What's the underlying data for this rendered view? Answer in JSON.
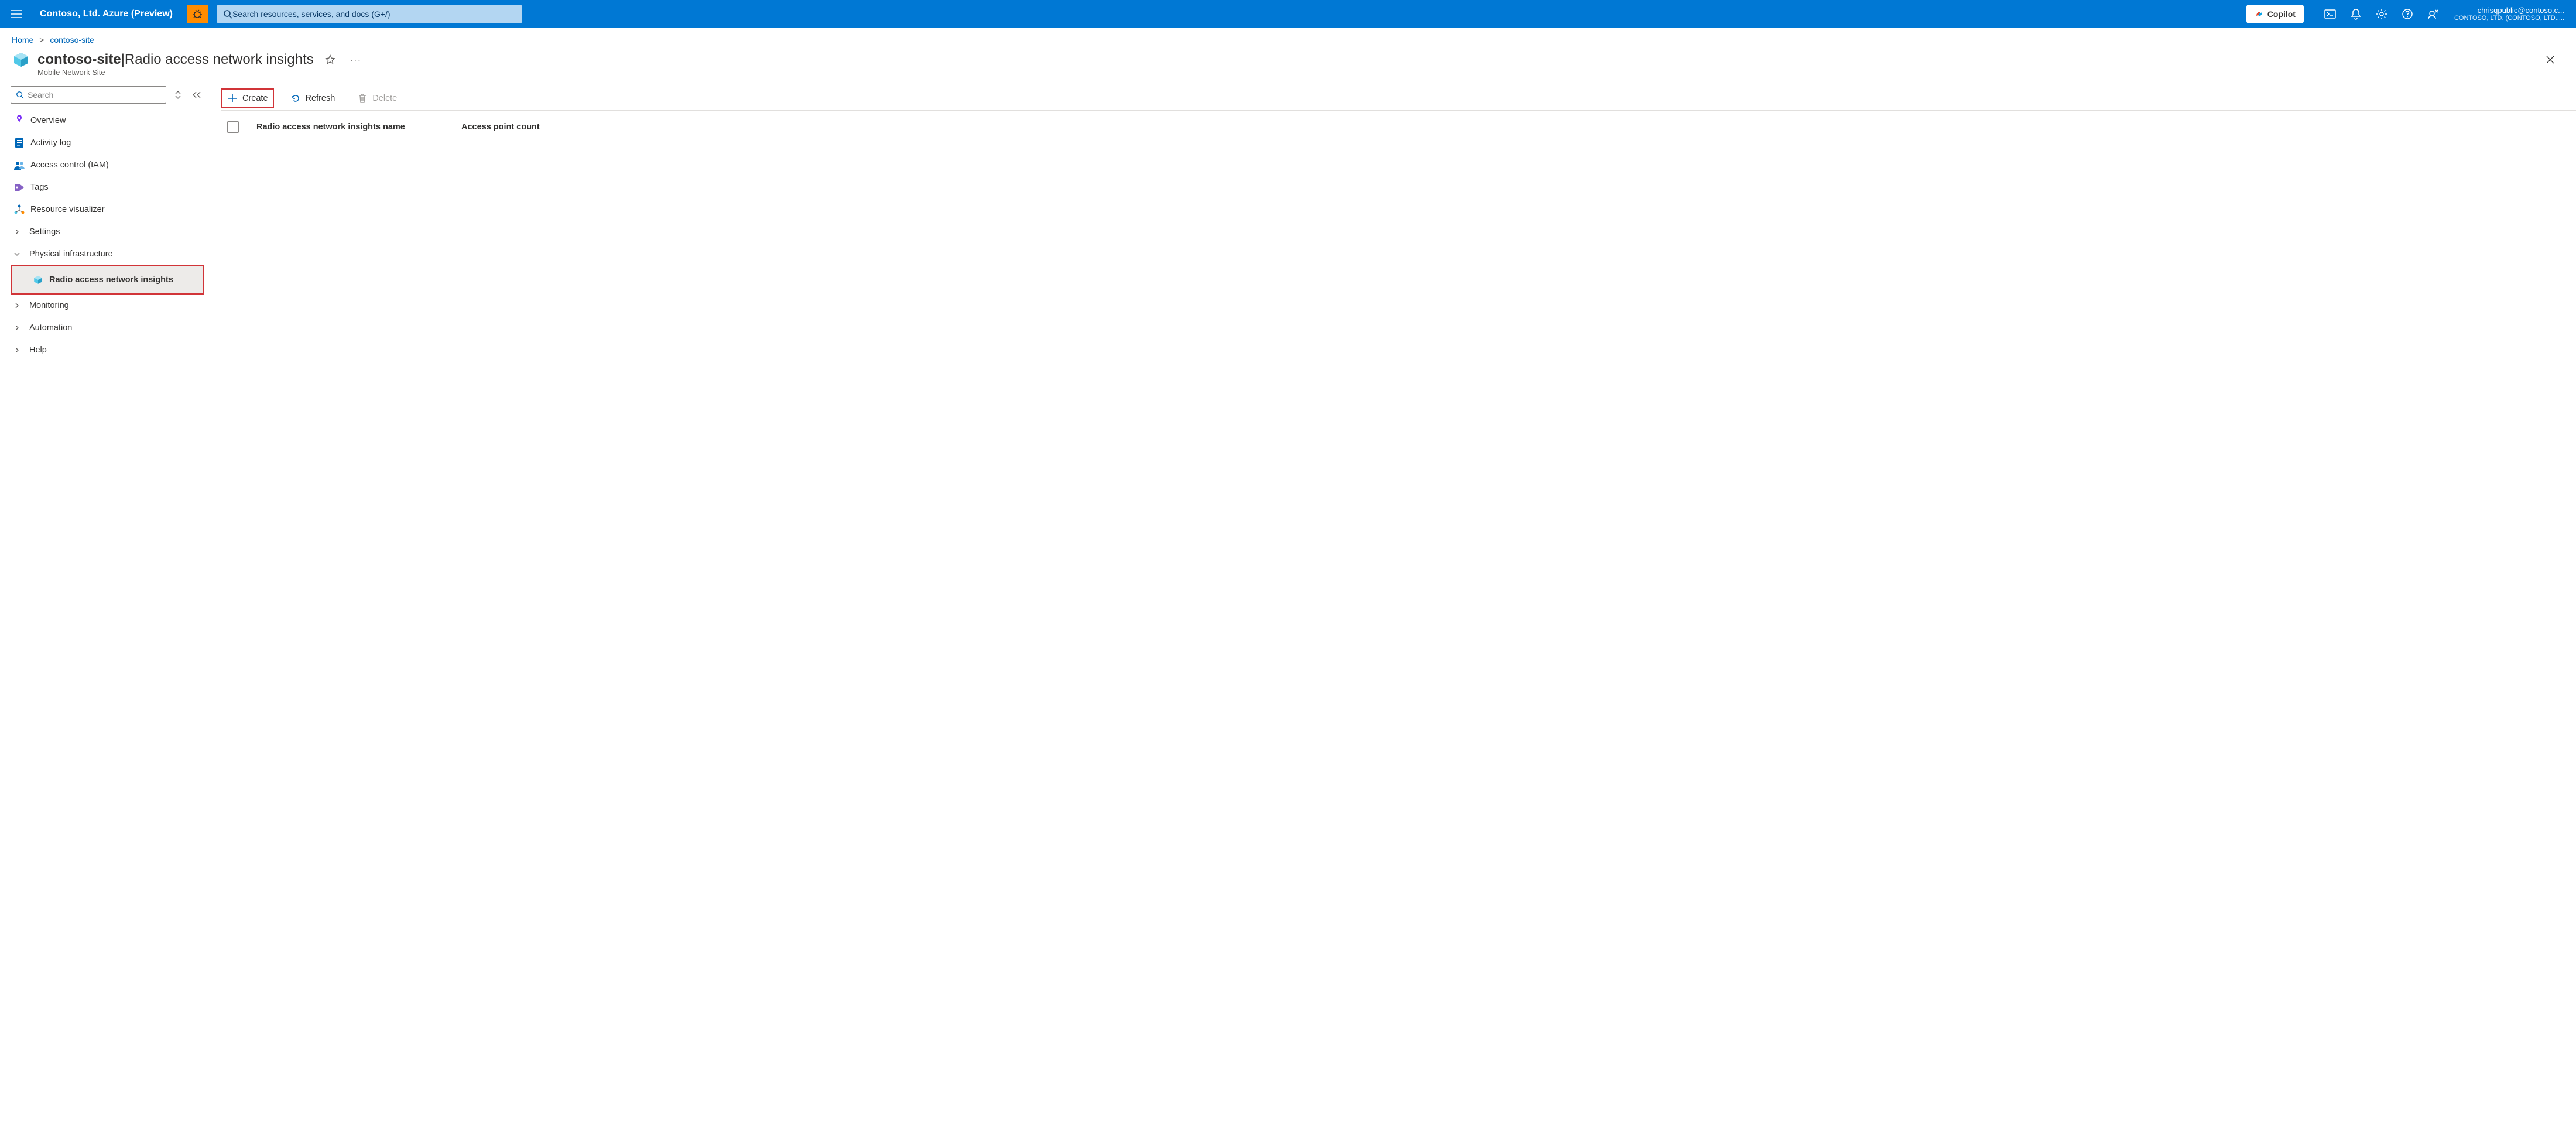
{
  "header": {
    "brand": "Contoso, Ltd. Azure (Preview)",
    "search_placeholder": "Search resources, services, and docs (G+/)",
    "copilot_label": "Copilot",
    "account_email": "chrisqpublic@contoso.c...",
    "account_tenant": "CONTOSO, LTD. (CONTOSO, LTD....."
  },
  "breadcrumb": {
    "items": [
      "Home",
      "contoso-site"
    ]
  },
  "page": {
    "title_strong": "contoso-site",
    "title_sep": " | ",
    "title_light": "Radio access network insights",
    "subtitle": "Mobile Network Site"
  },
  "sidebar": {
    "search_placeholder": "Search",
    "items": [
      {
        "label": "Overview"
      },
      {
        "label": "Activity log"
      },
      {
        "label": "Access control (IAM)"
      },
      {
        "label": "Tags"
      },
      {
        "label": "Resource visualizer"
      },
      {
        "label": "Settings"
      },
      {
        "label": "Physical infrastructure"
      },
      {
        "label": "Radio access network insights"
      },
      {
        "label": "Monitoring"
      },
      {
        "label": "Automation"
      },
      {
        "label": "Help"
      }
    ]
  },
  "toolbar": {
    "create": "Create",
    "refresh": "Refresh",
    "delete": "Delete"
  },
  "table": {
    "col_name": "Radio access network insights name",
    "col_count": "Access point count"
  }
}
